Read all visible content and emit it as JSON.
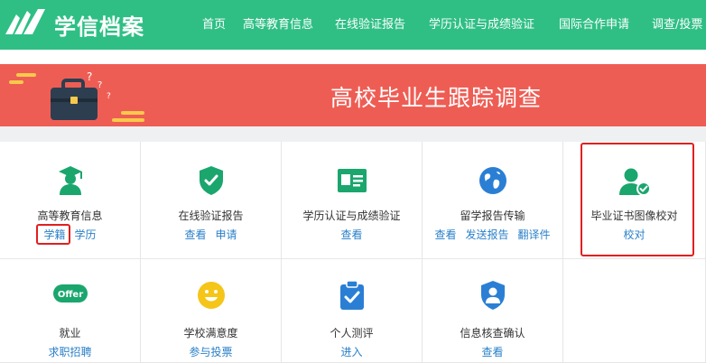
{
  "brand": {
    "name": "学信档案"
  },
  "nav": [
    "首页",
    "高等教育信息",
    "在线验证报告",
    "学历认证与成绩验证",
    "国际合作申请",
    "调查/投票"
  ],
  "banner": {
    "title": "高校毕业生跟踪调查"
  },
  "services": [
    {
      "title": "高等教育信息",
      "links": [
        "学籍",
        "学历"
      ],
      "icon": "graduate-icon"
    },
    {
      "title": "在线验证报告",
      "links": [
        "查看",
        "申请"
      ],
      "icon": "shield-check-icon"
    },
    {
      "title": "学历认证与成绩验证",
      "links": [
        "查看"
      ],
      "icon": "id-card-icon"
    },
    {
      "title": "留学报告传输",
      "links": [
        "查看",
        "发送报告",
        "翻译件"
      ],
      "icon": "globe-icon"
    },
    {
      "title": "毕业证书图像校对",
      "links": [
        "校对"
      ],
      "icon": "user-check-icon"
    },
    {
      "title": "就业",
      "links": [
        "求职招聘"
      ],
      "icon": "offer-icon",
      "icon_text": "Offer"
    },
    {
      "title": "学校满意度",
      "links": [
        "参与投票"
      ],
      "icon": "smiley-icon"
    },
    {
      "title": "个人测评",
      "links": [
        "进入"
      ],
      "icon": "clipboard-check-icon"
    },
    {
      "title": "信息核查确认",
      "links": [
        "查看"
      ],
      "icon": "user-shield-icon"
    }
  ],
  "colors": {
    "brand_green": "#2fbf85",
    "banner_red": "#ee5d54",
    "link_blue": "#2a80c9",
    "highlight_red": "#e02020"
  }
}
